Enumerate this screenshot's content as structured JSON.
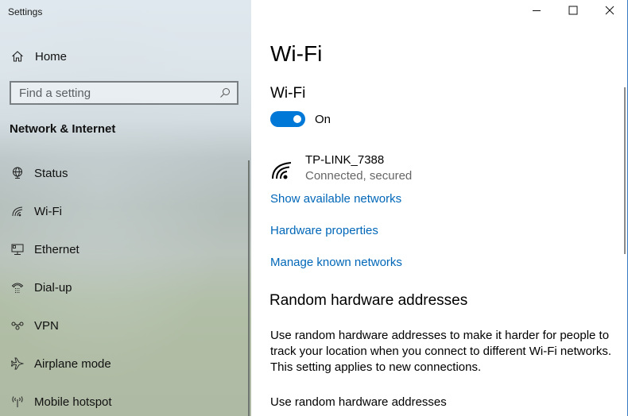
{
  "window": {
    "title": "Settings",
    "controls": {
      "minimize": "minimize-icon",
      "maximize": "maximize-icon",
      "close": "close-icon"
    }
  },
  "sidebar": {
    "home_label": "Home",
    "search_placeholder": "Find a setting",
    "search_value": "",
    "section_title": "Network & Internet",
    "items": [
      {
        "label": "Status",
        "icon": "globe-icon"
      },
      {
        "label": "Wi-Fi",
        "icon": "wifi-icon"
      },
      {
        "label": "Ethernet",
        "icon": "ethernet-icon"
      },
      {
        "label": "Dial-up",
        "icon": "phone-icon"
      },
      {
        "label": "VPN",
        "icon": "vpn-icon"
      },
      {
        "label": "Airplane mode",
        "icon": "airplane-icon"
      },
      {
        "label": "Mobile hotspot",
        "icon": "hotspot-icon"
      }
    ]
  },
  "main": {
    "page_title": "Wi-Fi",
    "wifi_section_title": "Wi-Fi",
    "wifi_toggle": {
      "state": true,
      "label": "On"
    },
    "network": {
      "name": "TP-LINK_7388",
      "status": "Connected, secured"
    },
    "links": [
      "Show available networks",
      "Hardware properties",
      "Manage known networks"
    ],
    "random_section": {
      "title": "Random hardware addresses",
      "description": "Use random hardware addresses to make it harder for people to track your location when you connect to different Wi-Fi networks. This setting applies to new connections.",
      "setting_label": "Use random hardware addresses"
    }
  },
  "colors": {
    "accent": "#0078d7",
    "link": "#0067b8"
  }
}
